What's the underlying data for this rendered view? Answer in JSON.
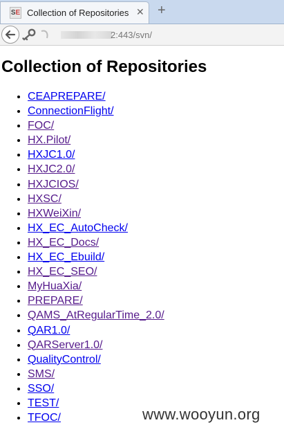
{
  "browser": {
    "tab_title": "Collection of Repositories",
    "tab_close": "✕",
    "new_tab": "+",
    "favicon_text_s": "S",
    "favicon_text_e": "E",
    "url_text": "2:443/svn/"
  },
  "page": {
    "title": "Collection of Repositories",
    "repos": [
      {
        "label": "CEAPREPARE/",
        "visited": false
      },
      {
        "label": "ConnectionFlight/",
        "visited": false
      },
      {
        "label": "FOC/",
        "visited": true
      },
      {
        "label": "HX.Pilot/",
        "visited": true
      },
      {
        "label": "HXJC1.0/",
        "visited": false
      },
      {
        "label": "HXJC2.0/",
        "visited": true
      },
      {
        "label": "HXJCIOS/",
        "visited": true
      },
      {
        "label": "HXSC/",
        "visited": true
      },
      {
        "label": "HXWeiXin/",
        "visited": true
      },
      {
        "label": "HX_EC_AutoCheck/",
        "visited": false
      },
      {
        "label": "HX_EC_Docs/",
        "visited": true
      },
      {
        "label": "HX_EC_Ebuild/",
        "visited": false
      },
      {
        "label": "HX_EC_SEO/",
        "visited": true
      },
      {
        "label": "MyHuaXia/",
        "visited": true
      },
      {
        "label": "PREPARE/",
        "visited": true
      },
      {
        "label": "QAMS_AtRegularTime_2.0/",
        "visited": true
      },
      {
        "label": "QAR1.0/",
        "visited": false
      },
      {
        "label": "QARServer1.0/",
        "visited": true
      },
      {
        "label": "QualityControl/",
        "visited": false
      },
      {
        "label": "SMS/",
        "visited": true
      },
      {
        "label": "SSO/",
        "visited": false
      },
      {
        "label": "TEST/",
        "visited": false
      },
      {
        "label": "TFOC/",
        "visited": false
      }
    ]
  },
  "watermark": "www.wooyun.org",
  "colors": {
    "link": "#0000ee",
    "visited_link": "#551a8b"
  }
}
